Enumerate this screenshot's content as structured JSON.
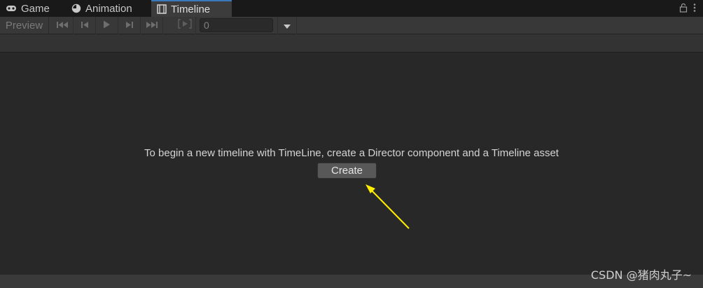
{
  "tabs": [
    {
      "label": "Game",
      "icon": "gamepad-icon"
    },
    {
      "label": "Animation",
      "icon": "clock-icon"
    },
    {
      "label": "Timeline",
      "icon": "film-icon",
      "active": true
    }
  ],
  "toolbar": {
    "preview_label": "Preview",
    "frame_value": "0"
  },
  "main": {
    "message": "To begin a new timeline with TimeLine, create a Director component and a Timeline asset",
    "create_label": "Create"
  },
  "watermark": "CSDN @猪肉丸子~",
  "colors": {
    "background": "#282828",
    "toolbar": "#383838",
    "active_tab_accent": "#3a79bb",
    "annotation_arrow": "#ffee00"
  }
}
